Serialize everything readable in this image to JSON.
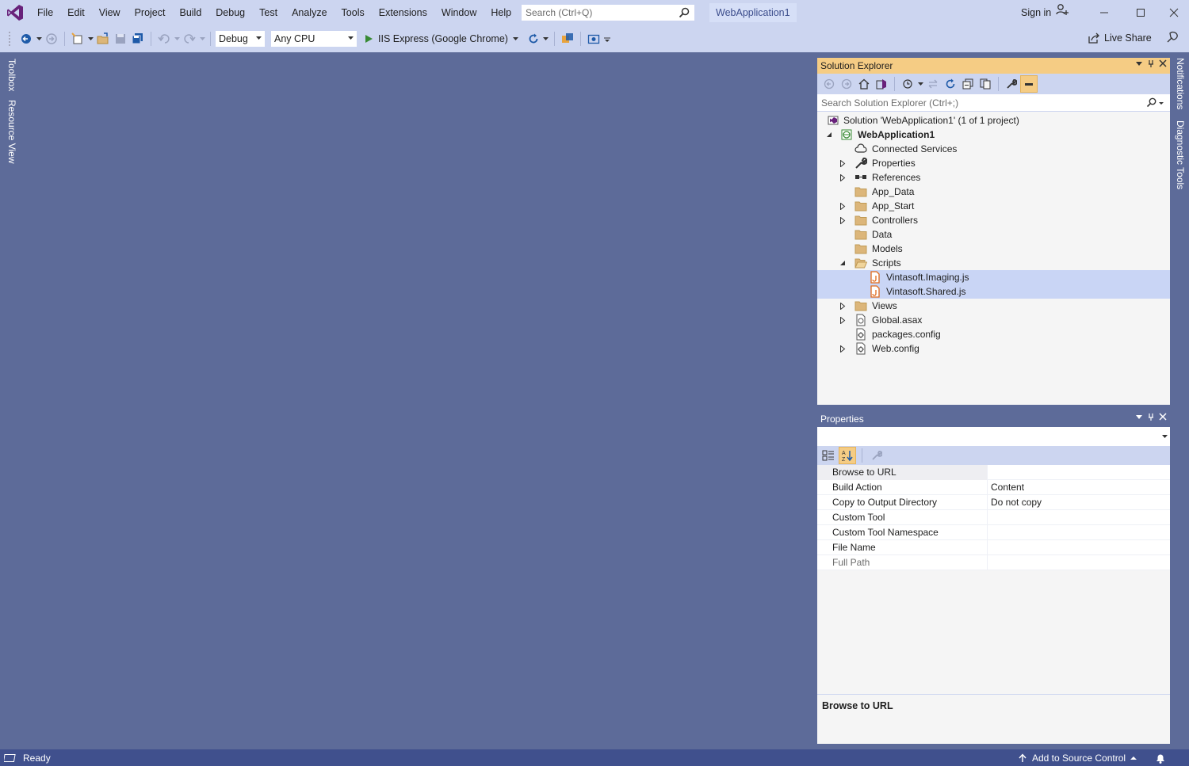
{
  "menu": {
    "items": [
      "File",
      "Edit",
      "View",
      "Project",
      "Build",
      "Debug",
      "Test",
      "Analyze",
      "Tools",
      "Extensions",
      "Window",
      "Help"
    ]
  },
  "search": {
    "placeholder": "Search (Ctrl+Q)"
  },
  "solution_name": "WebApplication1",
  "signin": "Sign in",
  "toolbar": {
    "config": "Debug",
    "platform": "Any CPU",
    "run_target": "IIS Express (Google Chrome)"
  },
  "liveshare": "Live Share",
  "left_tabs": {
    "toolbox": "Toolbox",
    "resource_view": "Resource View"
  },
  "right_tabs": {
    "notifications": "Notifications",
    "diagnostic_tools": "Diagnostic Tools"
  },
  "solution_explorer": {
    "title": "Solution Explorer",
    "search_placeholder": "Search Solution Explorer (Ctrl+;)",
    "tree": [
      {
        "label": "Solution 'WebApplication1' (1 of 1 project)",
        "icon": "solution-icon",
        "level": 0,
        "expander": "none",
        "bold": false
      },
      {
        "label": "WebApplication1",
        "icon": "web-project-icon",
        "level": 0,
        "expander": "expanded",
        "bold": true
      },
      {
        "label": "Connected Services",
        "icon": "connected-services-icon",
        "level": 1,
        "expander": "none"
      },
      {
        "label": "Properties",
        "icon": "wrench-icon",
        "level": 1,
        "expander": "collapsed"
      },
      {
        "label": "References",
        "icon": "references-icon",
        "level": 1,
        "expander": "collapsed"
      },
      {
        "label": "App_Data",
        "icon": "folder-icon",
        "level": 1,
        "expander": "none"
      },
      {
        "label": "App_Start",
        "icon": "folder-icon",
        "level": 1,
        "expander": "collapsed"
      },
      {
        "label": "Controllers",
        "icon": "folder-icon",
        "level": 1,
        "expander": "collapsed"
      },
      {
        "label": "Data",
        "icon": "folder-icon",
        "level": 1,
        "expander": "none"
      },
      {
        "label": "Models",
        "icon": "folder-icon",
        "level": 1,
        "expander": "none"
      },
      {
        "label": "Scripts",
        "icon": "folder-open-icon",
        "level": 1,
        "expander": "expanded"
      },
      {
        "label": "Vintasoft.Imaging.js",
        "icon": "js-file-icon",
        "level": 2,
        "expander": "none",
        "selected": true
      },
      {
        "label": "Vintasoft.Shared.js",
        "icon": "js-file-icon",
        "level": 2,
        "expander": "none",
        "selected": true
      },
      {
        "label": "Views",
        "icon": "folder-icon",
        "level": 1,
        "expander": "collapsed"
      },
      {
        "label": "Global.asax",
        "icon": "asax-file-icon",
        "level": 1,
        "expander": "collapsed"
      },
      {
        "label": "packages.config",
        "icon": "config-file-icon",
        "level": 1,
        "expander": "none"
      },
      {
        "label": "Web.config",
        "icon": "config-file-icon",
        "level": 1,
        "expander": "collapsed"
      }
    ]
  },
  "properties": {
    "title": "Properties",
    "rows": [
      {
        "name": "Browse to URL",
        "value": ""
      },
      {
        "name": "Build Action",
        "value": "Content"
      },
      {
        "name": "Copy to Output Directory",
        "value": "Do not copy"
      },
      {
        "name": "Custom Tool",
        "value": ""
      },
      {
        "name": "Custom Tool Namespace",
        "value": ""
      },
      {
        "name": "File Name",
        "value": ""
      },
      {
        "name": "Full Path",
        "value": ""
      }
    ],
    "description": "Browse to URL"
  },
  "status": {
    "text": "Ready",
    "source_control": "Add to Source Control"
  },
  "colors": {
    "accent": "#68217a",
    "chrome": "#ccd5f0",
    "background": "#5d6b99",
    "statusbar": "#40508d",
    "active_tab": "#f5cc84"
  }
}
